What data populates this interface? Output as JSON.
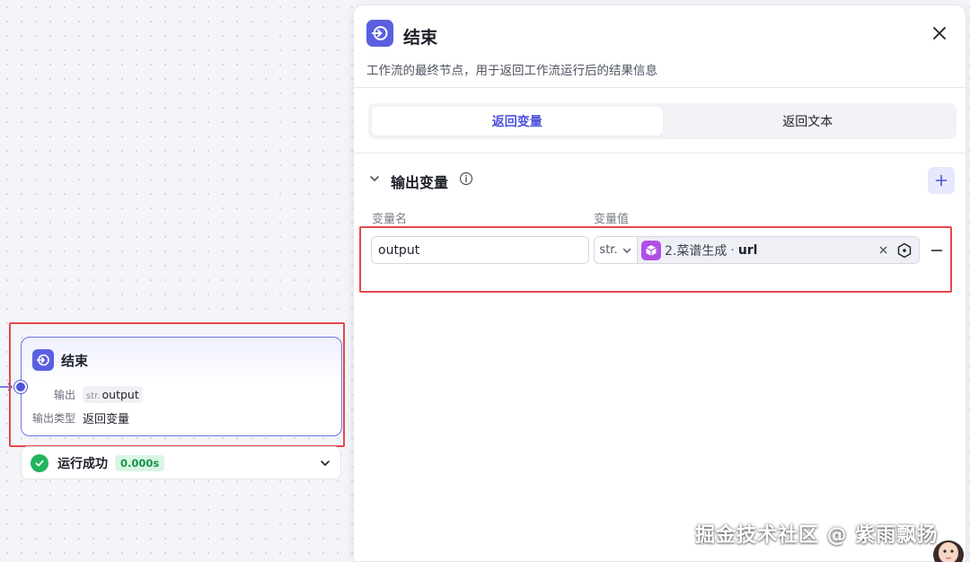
{
  "canvas_node": {
    "title": "结束",
    "output_label": "输出",
    "output_type_tag": "str.",
    "output_name": "output",
    "output_type_label": "输出类型",
    "output_type_value": "返回变量"
  },
  "run_status": {
    "text": "运行成功",
    "time": "0.000s"
  },
  "panel": {
    "title": "结束",
    "description": "工作流的最终节点，用于返回工作流运行后的结果信息",
    "tabs": [
      {
        "label": "返回变量",
        "active": true
      },
      {
        "label": "返回文本",
        "active": false
      }
    ],
    "section_title": "输出变量",
    "col_name": "变量名",
    "col_value": "变量值",
    "rows": [
      {
        "name": "output",
        "type": "str.",
        "ref_node": "2.菜谱生成",
        "ref_sep": "·",
        "ref_field": "url"
      }
    ]
  },
  "watermark": "掘金技术社区 @ 紫雨飘扬",
  "colors": {
    "accent": "#4d52d9",
    "node_icon": "#5a5fe0",
    "highlight_red": "#e5484d",
    "success_green": "#22b35e",
    "ref_node_icon": "#b04fe8"
  },
  "icons": {
    "end_node": "end-node-icon",
    "close": "close-icon",
    "chevron": "chevron-down-icon",
    "info": "info-icon",
    "add": "plus-icon",
    "cube": "cube-icon",
    "clear": "clear-icon",
    "target": "target-icon",
    "remove": "minus-icon",
    "check": "check-icon"
  }
}
